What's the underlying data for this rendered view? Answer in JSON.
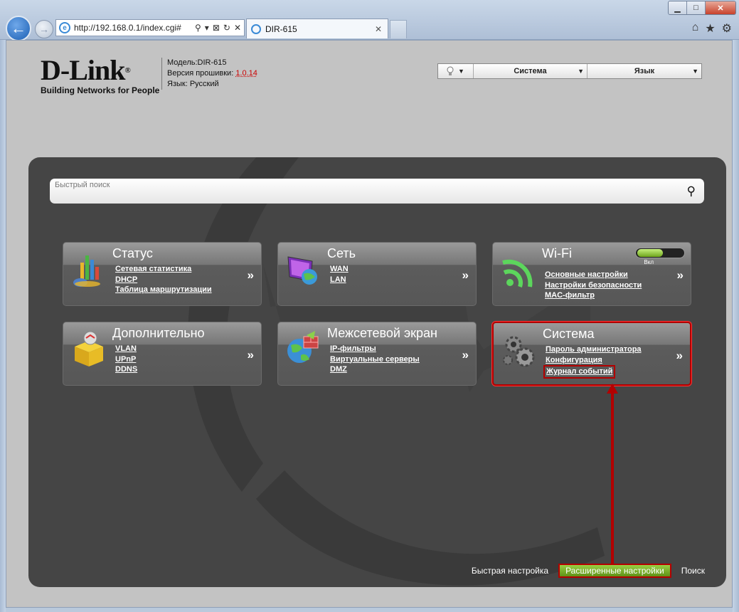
{
  "browser": {
    "url": "http://192.168.0.1/index.cgi#",
    "tab_title": "DIR-615",
    "window_buttons": {
      "minimize": "▁",
      "maximize": "□",
      "close": "✕"
    },
    "address_tools": {
      "search": "⚲",
      "dropdown": "▾",
      "compat": "⊠",
      "refresh": "↻",
      "stop": "✕"
    },
    "tab_close": "✕",
    "right_icons": {
      "home": "⌂",
      "favorites": "★",
      "settings": "⚙"
    }
  },
  "header": {
    "logo_text": "D-Link",
    "logo_mark": "®",
    "tagline": "Building Networks for People",
    "model_label": "Модель:",
    "model_value": "DIR-615",
    "firmware_label": "Версия прошивки:",
    "firmware_value": "1.0.14",
    "language_label": "Язык:",
    "language_value": "Русский"
  },
  "topbar": {
    "bulb_icon": "lightbulb-icon",
    "system_label": "Система",
    "language_label": "Язык",
    "arrow": "▼"
  },
  "search": {
    "placeholder": "Быстрый поиск",
    "icon": "⚲"
  },
  "tiles": [
    {
      "title": "Статус",
      "links": [
        "Сетевая статистика",
        "DHCP",
        "Таблица маршрутизации"
      ],
      "icon": "status-chart-icon"
    },
    {
      "title": "Сеть",
      "links": [
        "WAN",
        "LAN"
      ],
      "icon": "network-monitor-icon"
    },
    {
      "title": "Wi-Fi",
      "links": [
        "Основные настройки",
        "Настройки безопасности",
        "MAC-фильтр"
      ],
      "icon": "wifi-icon",
      "toggle_label": "Вкл",
      "toggle_on": true
    },
    {
      "title": "Дополнительно",
      "links": [
        "VLAN",
        "UPnP",
        "DDNS"
      ],
      "icon": "package-icon"
    },
    {
      "title": "Межсетевой экран",
      "links": [
        "IP-фильтры",
        "Виртуальные серверы",
        "DMZ"
      ],
      "icon": "firewall-globe-icon"
    },
    {
      "title": "Система",
      "links": [
        "Пароль администратора",
        "Конфигурация",
        "Журнал событий"
      ],
      "icon": "gears-icon",
      "highlighted": true,
      "highlighted_link": "Журнал событий"
    }
  ],
  "chevron": "»",
  "bottom_nav": {
    "quick_setup": "Быстрая настройка",
    "advanced": "Расширенные настройки",
    "search": "Поиск"
  },
  "colors": {
    "highlight": "#b20000",
    "active_green": "#7cb529",
    "panel": "#454545"
  }
}
